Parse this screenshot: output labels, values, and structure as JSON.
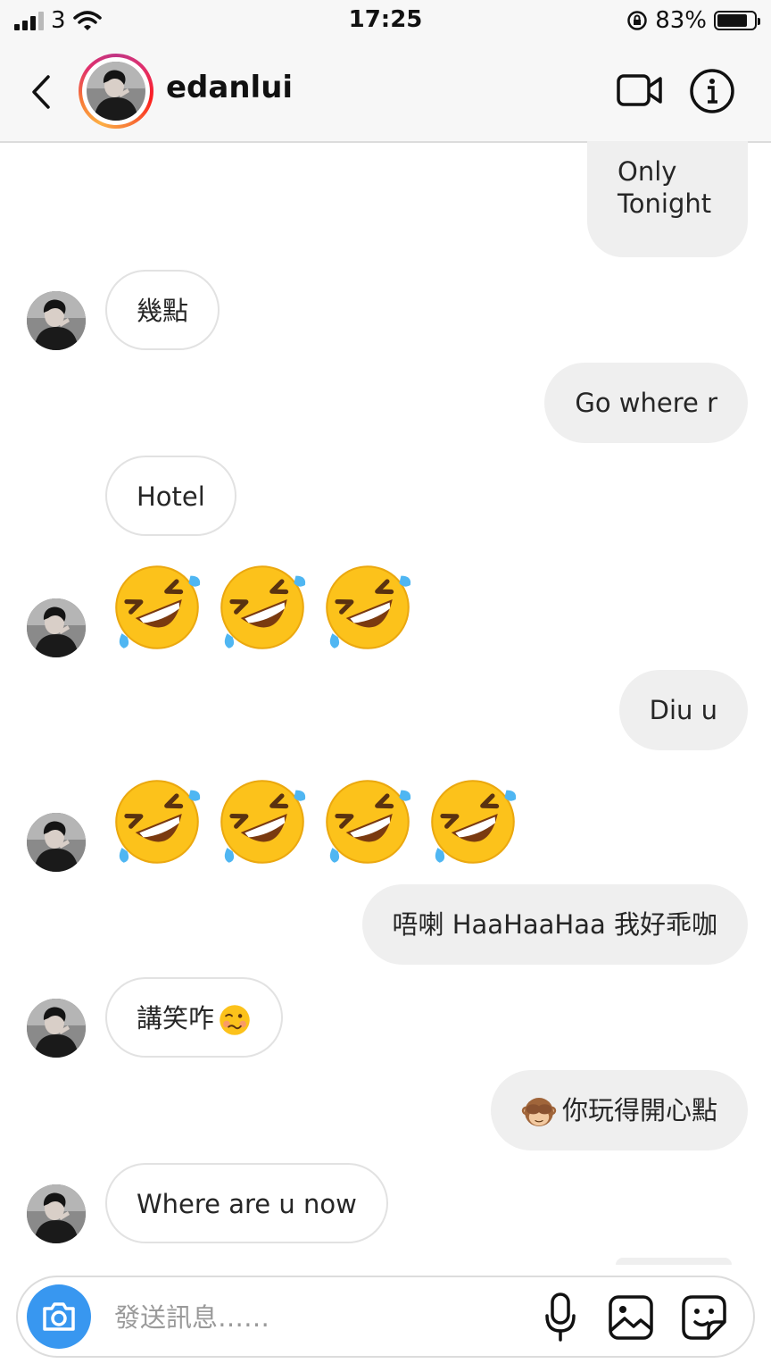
{
  "status_bar": {
    "carrier": "3",
    "time": "17:25",
    "battery_percent": "83%",
    "battery_level": 0.83,
    "icons": [
      "signal-icon",
      "wifi-icon",
      "rotation-lock-icon",
      "battery-icon"
    ]
  },
  "header": {
    "username": "edanlui",
    "icons": [
      "back-icon",
      "video-call-icon",
      "info-icon"
    ],
    "story_ring_colors": [
      "#c13584",
      "#e1306c",
      "#fd1d1d",
      "#f77737",
      "#fcaf45"
    ]
  },
  "messages": [
    {
      "side": "outgoing",
      "text": "Only Tonight"
    },
    {
      "side": "incoming",
      "text": "幾點"
    },
    {
      "side": "outgoing",
      "text": "Go where r"
    },
    {
      "side": "incoming",
      "text": "Hotel"
    },
    {
      "side": "incoming",
      "emoji": "rolling-on-floor-laughing",
      "count": 3
    },
    {
      "side": "outgoing",
      "text": "Diu u"
    },
    {
      "side": "incoming",
      "emoji": "rolling-on-floor-laughing",
      "count": 4
    },
    {
      "side": "outgoing",
      "text": "唔喇 HaaHaaHaa 我好乖咖"
    },
    {
      "side": "incoming",
      "text": "講笑咋",
      "trailing_emoji": "woozy-face"
    },
    {
      "side": "outgoing",
      "text": "你玩得開心點",
      "leading_emoji": "see-no-evil-monkey"
    },
    {
      "side": "incoming",
      "text": "Where are u now"
    }
  ],
  "composer": {
    "placeholder": "發送訊息……",
    "icons": [
      "camera-icon",
      "microphone-icon",
      "gallery-icon",
      "sticker-icon"
    ]
  },
  "colors": {
    "accent_blue": "#3897f0",
    "outgoing_bubble": "#efefef",
    "incoming_border": "#e2e2e2",
    "header_bg": "#f7f7f7"
  }
}
